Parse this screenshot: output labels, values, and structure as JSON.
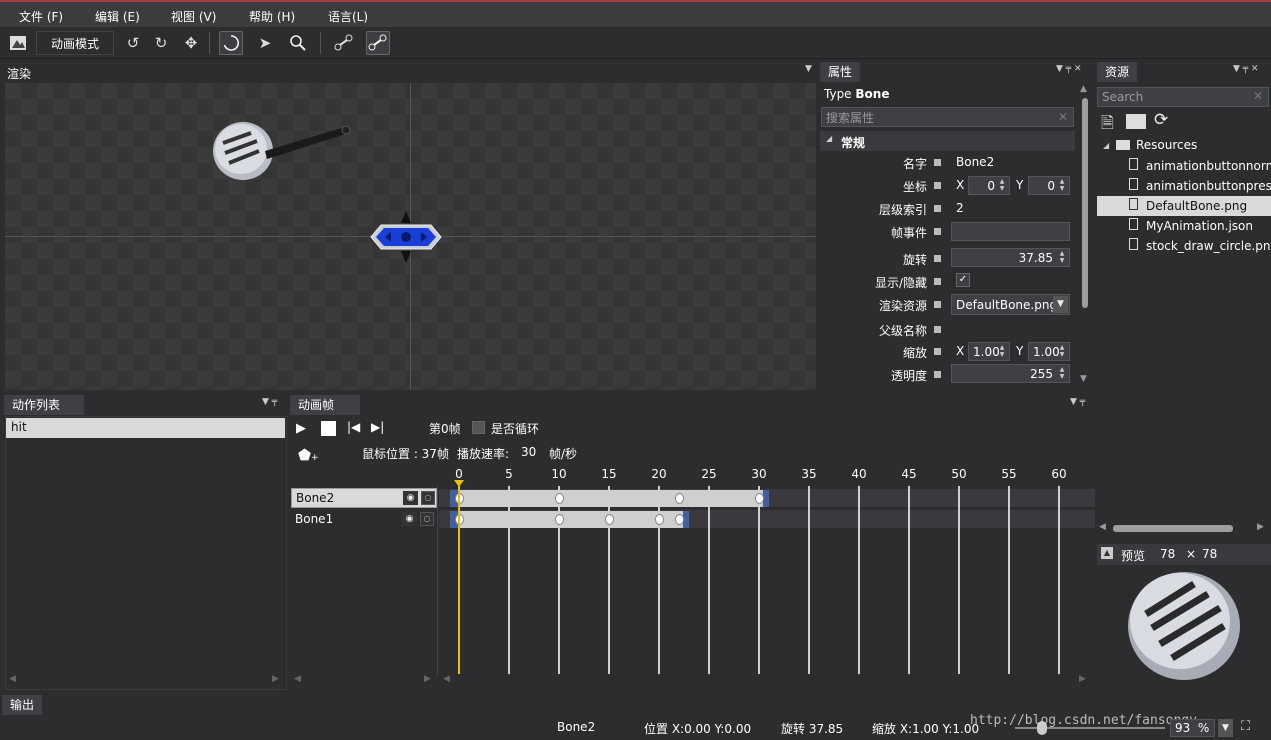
{
  "menu": [
    "文件 (F)",
    "编辑 (E)",
    "视图 (V)",
    "帮助 (H)",
    "语言(L)"
  ],
  "toolbar": {
    "mode_label": "动画模式"
  },
  "render_panel": {
    "title": "渲染"
  },
  "properties": {
    "title": "属性",
    "type_label": "Type",
    "type_value": "Bone",
    "search_placeholder": "搜索属性",
    "section": "常规",
    "name_label": "名字",
    "name_value": "Bone2",
    "coord_label": "坐标",
    "coord_x_label": "X",
    "coord_x": "0",
    "coord_y_label": "Y",
    "coord_y": "0",
    "layer_label": "层级索引",
    "layer_value": "2",
    "event_label": "帧事件",
    "event_value": "",
    "rotation_label": "旋转",
    "rotation_value": "37.85",
    "visible_label": "显示/隐藏",
    "visible_checked": true,
    "render_res_label": "渲染资源",
    "render_res_value": "DefaultBone.png",
    "parent_label": "父级名称",
    "scale_label": "缩放",
    "scale_x_label": "X",
    "scale_x": "1.00",
    "scale_y_label": "Y",
    "scale_y": "1.00",
    "opacity_label": "透明度",
    "opacity_value": "255"
  },
  "resources": {
    "title": "资源",
    "search_placeholder": "Search",
    "root": "Resources",
    "files": [
      "animationbuttonnormal.png",
      "animationbuttonpressed.png",
      "DefaultBone.png",
      "MyAnimation.json",
      "stock_draw_circle.png"
    ],
    "selected": "DefaultBone.png",
    "preview_label": "预览",
    "preview_w": "78",
    "preview_x": "×",
    "preview_h": "78"
  },
  "action_list": {
    "title": "动作列表",
    "items": [
      "hit"
    ]
  },
  "anim_frame": {
    "title": "动画帧",
    "frame_label": "第0帧",
    "loop_label": "是否循环",
    "mouse_pos": "鼠标位置 : 37帧",
    "rate_label": "播放速率:",
    "rate_value": "30",
    "rate_unit": "帧/秒",
    "ticks": [
      "0",
      "5",
      "10",
      "15",
      "20",
      "25",
      "30",
      "35",
      "40",
      "45",
      "50",
      "55",
      "60"
    ],
    "bones": [
      "Bone2",
      "Bone1"
    ],
    "bone2_keys": [
      0,
      10,
      22,
      30
    ],
    "bone1_keys": [
      0,
      10,
      15,
      20,
      22
    ]
  },
  "output": {
    "title": "输出"
  },
  "status": {
    "bone": "Bone2",
    "pos": "位置 X:0.00   Y:0.00",
    "rotation": "旋转  37.85",
    "scale": "缩放  X:1.00    Y:1.00",
    "zoom": "93",
    "zoom_unit": "%",
    "watermark": "http://blog.csdn.net/fansongy"
  }
}
